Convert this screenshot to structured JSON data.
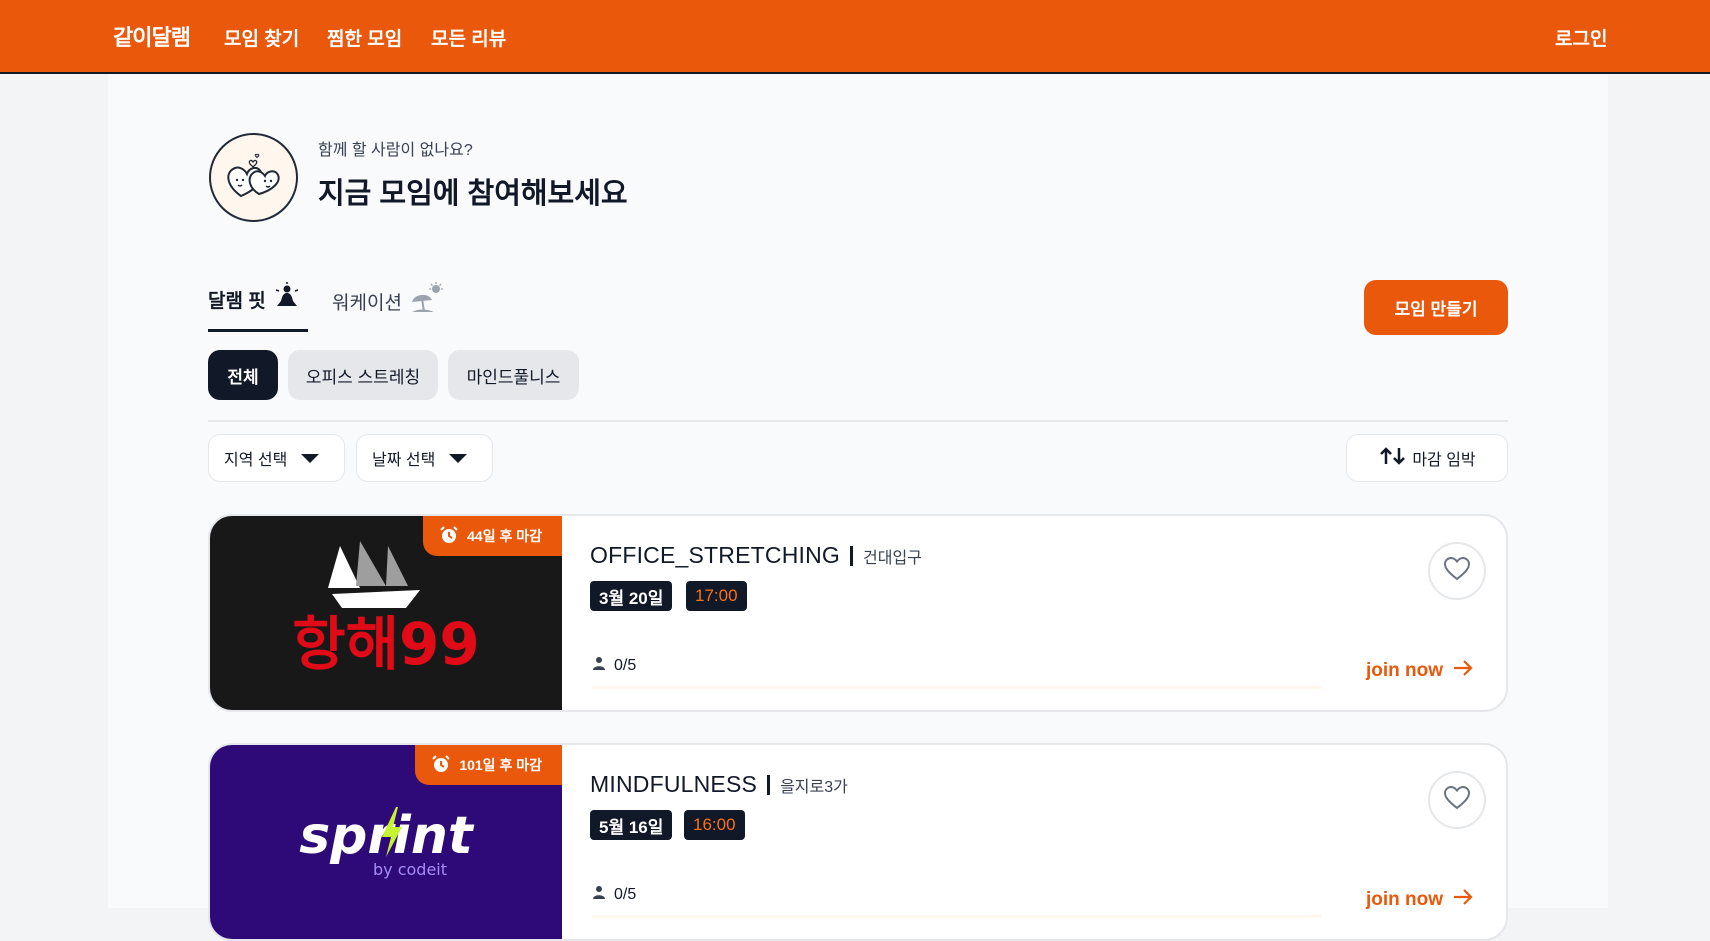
{
  "nav": {
    "brand": "같이달램",
    "links": [
      "모임 찾기",
      "찜한 모임",
      "모든 리뷰"
    ],
    "login": "로그인"
  },
  "hero": {
    "subtitle": "함께 할 사람이 없나요?",
    "title": "지금 모임에 참여해보세요"
  },
  "tabs": [
    {
      "label": "달램 핏",
      "icon": "meditation-icon",
      "active": true
    },
    {
      "label": "워케이션",
      "icon": "beach-umbrella-icon",
      "active": false
    }
  ],
  "create_button": "모임 만들기",
  "chips": [
    "전체",
    "오피스 스트레칭",
    "마인드풀니스"
  ],
  "filters": {
    "region": "지역 선택",
    "date": "날짜 선택",
    "sort": "마감 임박"
  },
  "cards": [
    {
      "deadline": "44일 후 마감",
      "title": "OFFICE_STRETCHING",
      "location": "건대입구",
      "date": "3월 20일",
      "time": "17:00",
      "participants": "0/5",
      "progress": 0,
      "join": "join now",
      "image": {
        "logo_text": "항해99",
        "bg": "#181818"
      }
    },
    {
      "deadline": "101일 후 마감",
      "title": "MINDFULNESS",
      "location": "을지로3가",
      "date": "5월 16일",
      "time": "16:00",
      "participants": "0/5",
      "progress": 0,
      "join": "join now",
      "image": {
        "logo_text": "sprint",
        "logo_sub": "by codeit",
        "bg": "#2e0a78"
      }
    }
  ],
  "colors": {
    "accent": "#ea580c",
    "dark": "#111827"
  }
}
